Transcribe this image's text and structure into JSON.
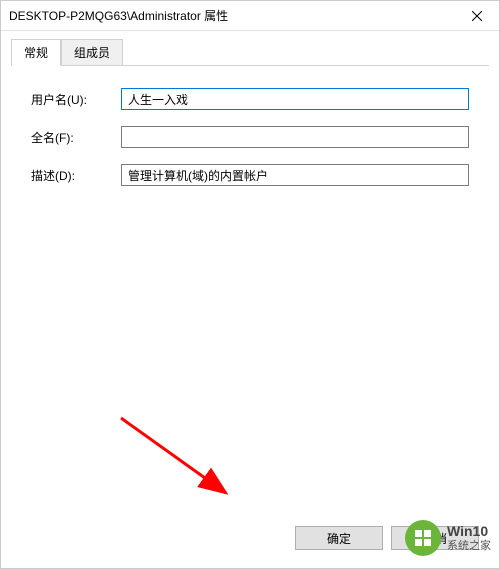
{
  "titlebar": {
    "title": "DESKTOP-P2MQG63\\Administrator 属性"
  },
  "tabs": {
    "general": "常规",
    "memberof": "组成员"
  },
  "form": {
    "username_label": "用户名(U):",
    "username_value": "人生一入戏",
    "fullname_label": "全名(F):",
    "fullname_value": "",
    "description_label": "描述(D):",
    "description_value": "管理计算机(域)的内置帐户"
  },
  "buttons": {
    "ok": "确定",
    "cancel": "取消"
  },
  "watermark": {
    "line1": "Win10",
    "line2": "系统之家"
  }
}
